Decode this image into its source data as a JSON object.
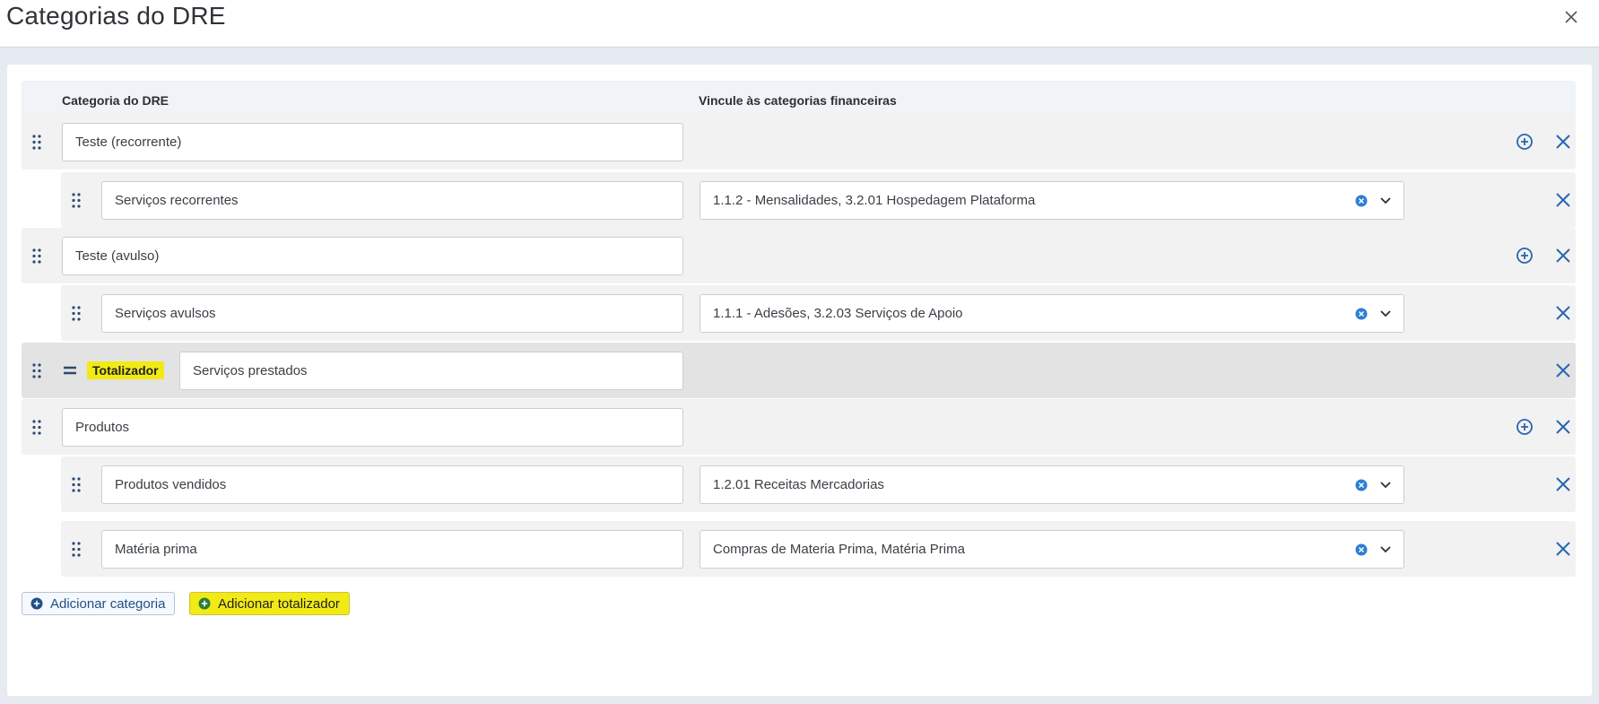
{
  "dialog": {
    "title": "Categorias do DRE",
    "close_icon": "close-icon"
  },
  "table": {
    "col_category": "Categoria do DRE",
    "col_link": "Vincule às categorias financeiras"
  },
  "rows": [
    {
      "type": "group",
      "name": "Teste (recorrente)"
    },
    {
      "type": "item",
      "name": "Serviços recorrentes",
      "link": "1.1.2 - Mensalidades, 3.2.01 Hospedagem Plataforma"
    },
    {
      "type": "group",
      "name": "Teste (avulso)"
    },
    {
      "type": "item",
      "name": "Serviços avulsos",
      "link": "1.1.1 - Adesões, 3.2.03 Serviços de Apoio"
    },
    {
      "type": "total",
      "badge": "Totalizador",
      "name": "Serviços prestados"
    },
    {
      "type": "group",
      "name": "Produtos"
    },
    {
      "type": "item",
      "name": "Produtos vendidos",
      "link": "1.2.01 Receitas Mercadorias"
    },
    {
      "type": "item",
      "name": "Matéria prima",
      "link": "Compras de Materia Prima, Matéria Prima"
    }
  ],
  "footer": {
    "add_category": "Adicionar categoria",
    "add_total": "Adicionar totalizador"
  },
  "colors": {
    "accent": "#2a66b0",
    "highlight": "#f2ea16",
    "row_bg": "#f2f2f2",
    "total_bg": "#e3e3e3"
  }
}
